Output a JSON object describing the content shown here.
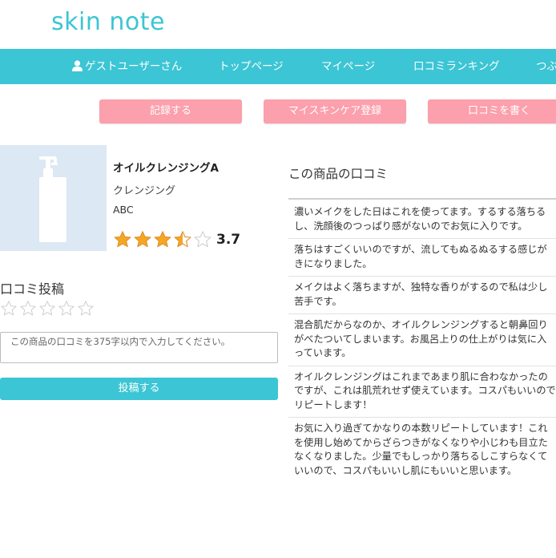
{
  "site": {
    "logo": "skin note"
  },
  "nav": {
    "user_label": "ゲストユーザーさん",
    "top_page": "トップページ",
    "my_page": "マイページ",
    "ranking": "口コミランキング",
    "more": "つぶ"
  },
  "actions": {
    "record": "記録する",
    "register_skincare": "マイスキンケア登録",
    "write_review": "口コミを書く"
  },
  "product": {
    "name": "オイルクレンジングA",
    "category": "クレンジング",
    "brand": "ABC",
    "rating": 3.7,
    "rating_display": "3.7"
  },
  "post": {
    "heading": "口コミ投稿",
    "selected_stars": 0,
    "textarea_placeholder": "この商品の口コミを375字以内で入力してください。",
    "textarea_value": "",
    "submit_label": "投稿する"
  },
  "reviews": {
    "title": "この商品の口コミ",
    "items": [
      "濃いメイクをした日はこれを使ってます。するする落ちるし、洗顔後のつっぱり感がないのでお気に入りです。",
      "落ちはすごくいいのですが、流してもぬるぬるする感じがきになりました。",
      "メイクはよく落ちますが、独特な香りがするので私は少し苦手です。",
      "混合肌だからなのか、オイルクレンジングすると朝鼻回りがべたついてしまいます。お風呂上りの仕上がりは気に入っています。",
      "オイルクレンジングはこれまであまり肌に合わなかったのですが、これは肌荒れせず使えています。コスパもいいのでリピートします！",
      "お気に入り過ぎてかなりの本数リピートしています！これを使用し始めてからざらつきがなくなりや小じわも目立たなくなりました。少量でもしっかり落ちるしこすらなくていいので、コスパもいいし肌にもいいと思います。"
    ]
  },
  "colors": {
    "brand": "#3cc5d4",
    "action_pink": "#fba0ac",
    "star_gold": "#f5a623",
    "thumb_bg": "#dce8f3"
  },
  "icons": {
    "user": "user-icon",
    "star": "star-icon",
    "product_image": "bottle-icon"
  }
}
